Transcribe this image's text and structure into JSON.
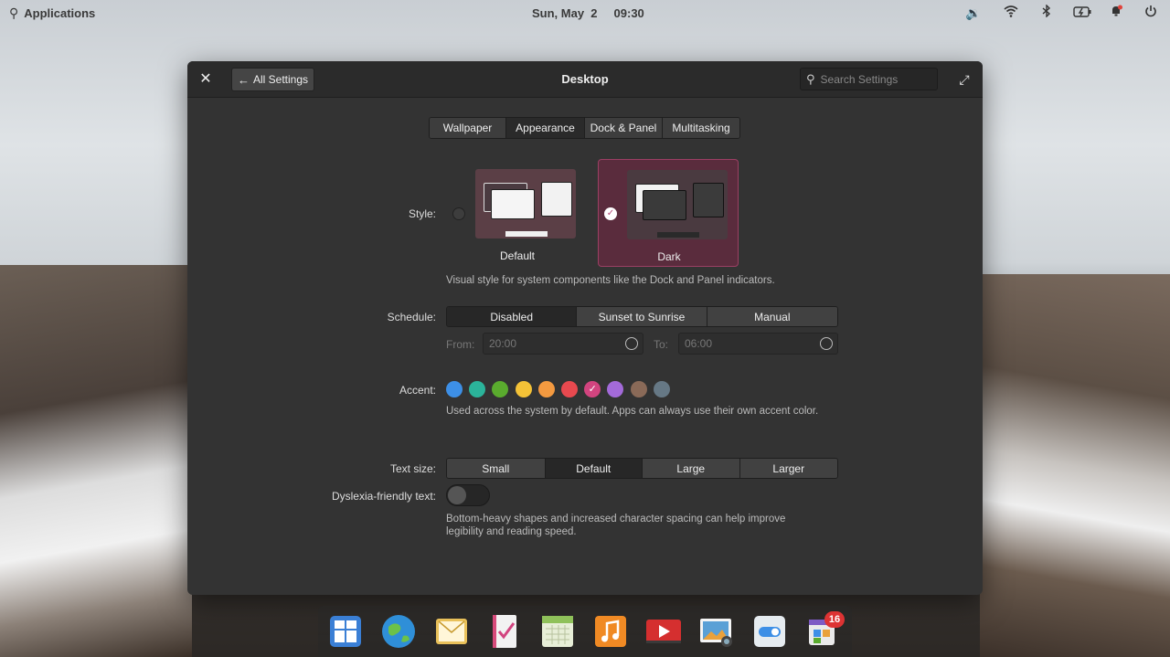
{
  "panel": {
    "applications": "Applications",
    "date": "Sun, May  2",
    "time": "09:30"
  },
  "window": {
    "title": "Desktop",
    "back_label": "All Settings",
    "search_placeholder": "Search Settings"
  },
  "tabs": [
    {
      "label": "Wallpaper"
    },
    {
      "label": "Appearance"
    },
    {
      "label": "Dock & Panel"
    },
    {
      "label": "Multitasking"
    }
  ],
  "style": {
    "label": "Style:",
    "options": [
      {
        "name": "Default"
      },
      {
        "name": "Dark"
      }
    ],
    "selected": "Dark",
    "description": "Visual style for system components like the Dock and Panel indicators."
  },
  "schedule": {
    "label": "Schedule:",
    "options": [
      {
        "label": "Disabled"
      },
      {
        "label": "Sunset to Sunrise"
      },
      {
        "label": "Manual"
      }
    ],
    "selected": "Disabled",
    "from_label": "From:",
    "from_value": "20:00",
    "to_label": "To:",
    "to_value": "06:00"
  },
  "accent": {
    "label": "Accent:",
    "colors": [
      "#3d8fe6",
      "#2bb39a",
      "#5aab2e",
      "#f4c237",
      "#f49a40",
      "#e8494f",
      "#d2447f",
      "#a36ad9",
      "#8a6a58",
      "#667885"
    ],
    "selected_index": 6,
    "description": "Used across the system by default. Apps can always use their own accent color."
  },
  "text_size": {
    "label": "Text size:",
    "options": [
      {
        "label": "Small"
      },
      {
        "label": "Default"
      },
      {
        "label": "Large"
      },
      {
        "label": "Larger"
      }
    ],
    "selected": "Default"
  },
  "dyslexia": {
    "label": "Dyslexia-friendly text:",
    "enabled": false,
    "description_line1": "Bottom-heavy shapes and increased character spacing can help improve",
    "description_line2": "legibility and reading speed."
  },
  "dock": {
    "apps": [
      {
        "name": "multitasking-view-icon",
        "color": "#3a7fd5"
      },
      {
        "name": "web-browser-icon",
        "color": "#2f8fd8"
      },
      {
        "name": "mail-icon",
        "color": "#e9c15a"
      },
      {
        "name": "tasks-icon",
        "color": "#f2f2f2"
      },
      {
        "name": "calendar-icon",
        "color": "#e7eed7"
      },
      {
        "name": "music-icon",
        "color": "#f08a24"
      },
      {
        "name": "videos-icon",
        "color": "#d52f2f"
      },
      {
        "name": "photos-icon",
        "color": "#5aa0d6"
      },
      {
        "name": "system-settings-icon",
        "color": "#e6ecf0"
      },
      {
        "name": "appcenter-icon",
        "color": "#eaeaea"
      }
    ],
    "appcenter_badge": "16"
  }
}
